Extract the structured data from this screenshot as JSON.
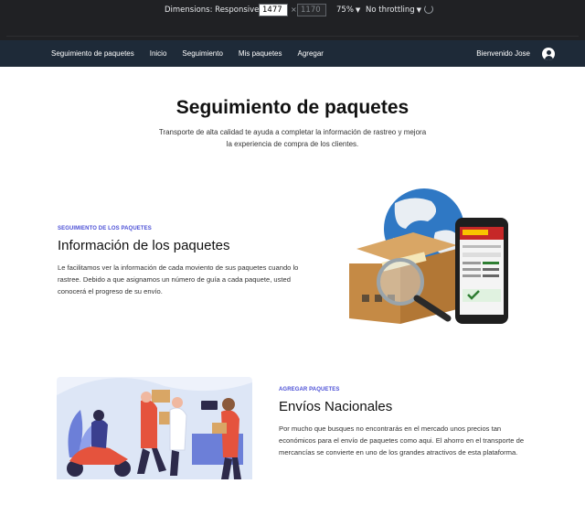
{
  "devtools": {
    "dimensions_label": "Dimensions: Responsive",
    "width_value": "1477",
    "times": "×",
    "height_placeholder": "1170",
    "zoom": "75%",
    "throttle": "No throttling"
  },
  "nav": {
    "links": [
      "Seguimiento de paquetes",
      "Inicio",
      "Seguimiento",
      "Mis paquetes",
      "Agregar"
    ],
    "greeting": "Bienvenido Jose"
  },
  "hero": {
    "title": "Seguimiento de paquetes",
    "subtitle": "Transporte de alta calidad te ayuda a completar la información de rastreo y mejora la experiencia de compra de los clientes."
  },
  "section1": {
    "eyebrow": "SEGUIMIENTO DE LOS PAQUETES",
    "title": "Información de los paquetes",
    "text": "Le facilitamos ver la información de cada moviento de sus paquetes cuando lo rastree. Debido a que asignamos un número de guía a cada paquete, usted conocerá el progreso de su envío."
  },
  "section2": {
    "eyebrow": "AGREGAR PAQUETES",
    "title": "Envíos Nacionales",
    "text": "Por mucho que busques no encontrarás en el mercado unos precios tan económicos para el envío de paquetes como aqui. El ahorro en el transporte de mercancías se convierte en uno de los grandes atractivos de esta plataforma."
  },
  "colors": {
    "nav_bg": "#1e2a38",
    "accent": "#4b4fd6",
    "devtools_bg": "#202124"
  },
  "icons": {
    "avatar": "user-circle-icon",
    "rotate": "rotate-icon"
  }
}
